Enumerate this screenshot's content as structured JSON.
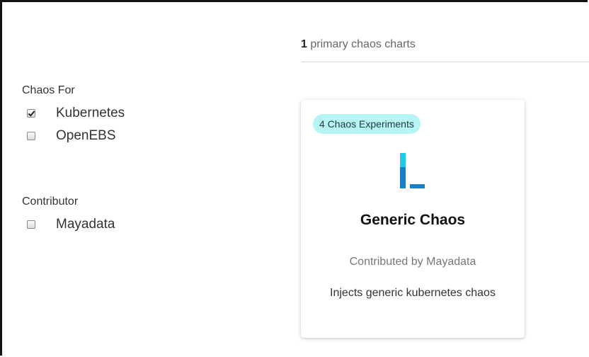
{
  "filters": {
    "groups": [
      {
        "title": "Chaos For",
        "options": [
          {
            "label": "Kubernetes",
            "checked": true
          },
          {
            "label": "OpenEBS",
            "checked": false
          }
        ]
      },
      {
        "title": "Contributor",
        "options": [
          {
            "label": "Mayadata",
            "checked": false
          }
        ]
      }
    ]
  },
  "results": {
    "count": "1",
    "label": "primary chaos charts"
  },
  "card": {
    "badge": "4 Chaos Experiments",
    "title": "Generic Chaos",
    "contributor": "Contributed by Mayadata",
    "description": "Injects generic kubernetes chaos",
    "logo_icon": "generic-chaos-logo",
    "colors": {
      "badge_bg": "#b7f4f4",
      "logo_light": "#29c5e6",
      "logo_dark": "#1a7fc4"
    }
  }
}
